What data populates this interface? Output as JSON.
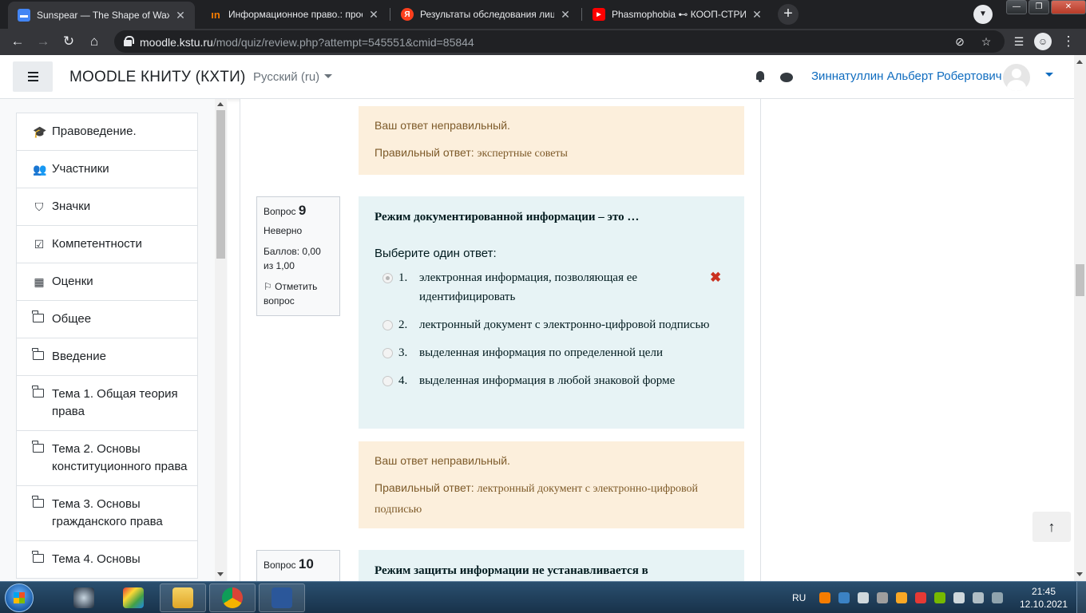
{
  "browser": {
    "tabs": [
      {
        "title": "Sunspear — The Shape of Wax",
        "icon": "chat-icon",
        "color": "#4285f4"
      },
      {
        "title": "Информационное право.: просм",
        "icon": "in-icon",
        "color": "#f57c00"
      },
      {
        "title": "Результаты обследования лица,",
        "icon": "yandex-icon",
        "color": "#fc3f1d"
      },
      {
        "title": "Phasmophobia ⊷ КООП-СТРИМ",
        "icon": "youtube-icon",
        "color": "#ff0000"
      }
    ],
    "url_host": "moodle.kstu.ru",
    "url_path": "/mod/quiz/review.php?attempt=545551&cmid=85844"
  },
  "navbar": {
    "brand": "MOODLE КНИТУ (КХТИ)",
    "language": "Русский (ru)",
    "username": "Зиннатуллин Альберт Робертович"
  },
  "drawer": {
    "items": [
      {
        "label": "Правоведение.",
        "icon": "graduation-cap-icon"
      },
      {
        "label": "Участники",
        "icon": "users-icon"
      },
      {
        "label": "Значки",
        "icon": "shield-icon"
      },
      {
        "label": "Компетентности",
        "icon": "checkbox-icon"
      },
      {
        "label": "Оценки",
        "icon": "table-icon"
      },
      {
        "label": "Общее",
        "icon": "folder-icon"
      },
      {
        "label": "Введение",
        "icon": "folder-icon"
      },
      {
        "label": "Тема 1. Общая теория права",
        "icon": "folder-icon"
      },
      {
        "label": "Тема 2. Основы конституционного права",
        "icon": "folder-icon"
      },
      {
        "label": "Тема 3. Основы гражданского права",
        "icon": "folder-icon"
      },
      {
        "label": "Тема 4. Основы",
        "icon": "folder-icon"
      }
    ]
  },
  "feedback_prev": {
    "status": "Ваш ответ неправильный.",
    "correct_prefix": "Правильный ответ:",
    "correct_value": "экспертные советы"
  },
  "q9": {
    "label": "Вопрос",
    "number": "9",
    "state": "Неверно",
    "grade": "Баллов: 0,00 из 1,00",
    "flag": "Отметить вопрос",
    "text": "Режим документированной информации – это …",
    "prompt": "Выберите один ответ:",
    "options": [
      {
        "num": "1.",
        "text": "электронная информация, позволяющая ее идентифицировать",
        "selected": true,
        "wrong": true
      },
      {
        "num": "2.",
        "text": "лектронный документ с электронно-цифровой подписью",
        "selected": false
      },
      {
        "num": "3.",
        "text": "выделенная информация по определенной цели",
        "selected": false
      },
      {
        "num": "4.",
        "text": "выделенная информация в любой знаковой форме",
        "selected": false
      }
    ],
    "wrong_mark": "✖",
    "feedback_status": "Ваш ответ неправильный.",
    "correct_prefix": "Правильный ответ:",
    "correct_value": "лектронный документ с электронно-цифровой подписью"
  },
  "q10": {
    "label": "Вопрос",
    "number": "10",
    "text": "Режим защиты информации не устанавливается в"
  },
  "taskbar": {
    "lang": "RU",
    "time": "21:45",
    "date": "12.10.2021"
  }
}
